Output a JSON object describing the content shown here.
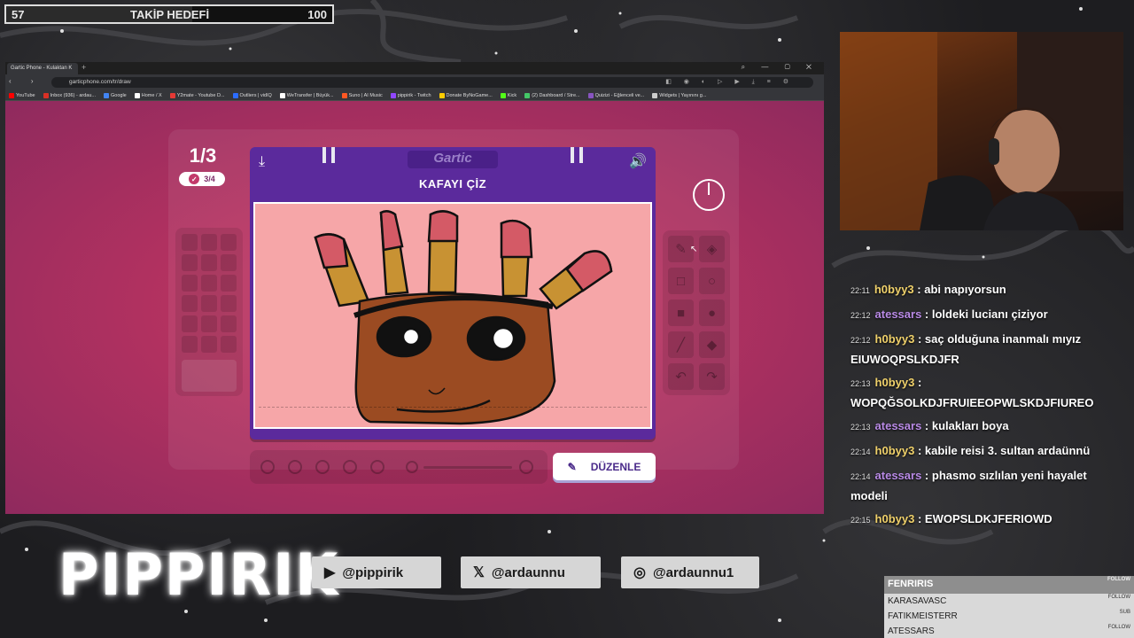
{
  "goal": {
    "current": "57",
    "label": "TAKİP HEDEFİ",
    "max": "100",
    "progress": 0.57
  },
  "browser": {
    "tab_title": "Gartic Phone - Kulaktan K",
    "url": "garticphone.com/tr/draw",
    "bookmarks": [
      {
        "label": "YouTube",
        "color": "#ff0000"
      },
      {
        "label": "Inbox (936) - ardau...",
        "color": "#d93025"
      },
      {
        "label": "Google",
        "color": "#4285f4"
      },
      {
        "label": "Home / X",
        "color": "#ffffff"
      },
      {
        "label": "Y2mate - Youtube D...",
        "color": "#e53935"
      },
      {
        "label": "Outliers | vidIQ",
        "color": "#2b6cff"
      },
      {
        "label": "WeTransfer | Büyük...",
        "color": "#ffffff"
      },
      {
        "label": "Suno | AI Music",
        "color": "#ff5722"
      },
      {
        "label": "pippirik - Twitch",
        "color": "#9146ff"
      },
      {
        "label": "Donate ByNoGame...",
        "color": "#ffcc00"
      },
      {
        "label": "Kick",
        "color": "#53fc18"
      },
      {
        "label": "(2) Dashboard / Stre...",
        "color": "#44c767"
      },
      {
        "label": "Quizizi - Eğlenceli ve...",
        "color": "#8854c0"
      },
      {
        "label": "Widgets | Yayınını g...",
        "color": "#cccccc"
      }
    ]
  },
  "game": {
    "round": "1/3",
    "count": "3/4",
    "logo": "Gartic",
    "prompt": "KAFAYI ÇİZ",
    "edit_button": "DÜZENLE"
  },
  "chat": [
    {
      "time": "22:11",
      "user": "h0byy3",
      "color": "gold",
      "text": "abi napıyorsun"
    },
    {
      "time": "22:12",
      "user": "atessars",
      "color": "purple",
      "text": "loldeki lucianı çiziyor"
    },
    {
      "time": "22:12",
      "user": "h0byy3",
      "color": "gold",
      "text": "saç olduğuna inanmalı mıyız EIUWOQPSLKDJFR"
    },
    {
      "time": "22:13",
      "user": "h0byy3",
      "color": "gold",
      "text": "WOPQĞSOLKDJFRUIEEOPWLSKDJFIUREO"
    },
    {
      "time": "22:13",
      "user": "atessars",
      "color": "purple",
      "text": "kulakları boya"
    },
    {
      "time": "22:14",
      "user": "h0byy3",
      "color": "gold",
      "text": "kabile reisi 3. sultan ardaünnü"
    },
    {
      "time": "22:14",
      "user": "atessars",
      "color": "purple",
      "text": "phasmo sızlılan yeni hayalet modeli"
    },
    {
      "time": "22:15",
      "user": "h0byy3",
      "color": "gold",
      "text": "EWOPSLDKJFERIOWD"
    }
  ],
  "brand": "PIPPIRIK",
  "socials": [
    {
      "icon": "youtube-icon",
      "glyph": "▶",
      "handle": "@pippirik"
    },
    {
      "icon": "x-icon",
      "glyph": "𝕏",
      "handle": "@ardaunnu"
    },
    {
      "icon": "instagram-icon",
      "glyph": "◎",
      "handle": "@ardaunnu1"
    }
  ],
  "recent": [
    {
      "name": "FENRIRIS",
      "tag": "FOLLOW"
    },
    {
      "name": "KARASAVASC",
      "tag": "FOLLOW"
    },
    {
      "name": "FATIKMEISTERR",
      "tag": "SUB"
    },
    {
      "name": "ATESSARS",
      "tag": "FOLLOW"
    }
  ]
}
